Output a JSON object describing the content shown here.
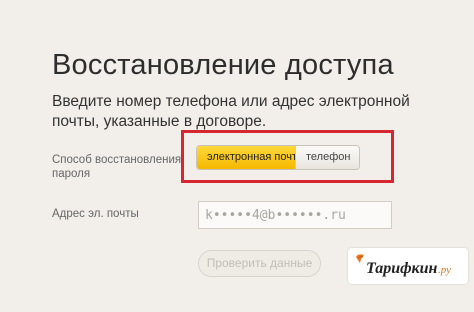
{
  "page": {
    "title": "Восстановление доступа",
    "instructions": "Введите номер телефона или адрес электронной почты, указанные в договоре."
  },
  "recovery_method": {
    "label": "Способ восстановления пароля",
    "options": [
      {
        "label": "электронная почта",
        "selected": true
      },
      {
        "label": "телефон",
        "selected": false
      }
    ]
  },
  "email": {
    "label": "Адрес эл. почты",
    "value": "k•••••4@b••••••.ru"
  },
  "submit": {
    "label": "Проверить данные",
    "enabled": false
  },
  "watermark": {
    "text": "Тарифкин",
    "suffix": ".ру"
  },
  "colors": {
    "background": "#f2efea",
    "accent_yellow": "#f5b800",
    "highlight_red": "#d6262f",
    "watermark_orange": "#e87722"
  }
}
